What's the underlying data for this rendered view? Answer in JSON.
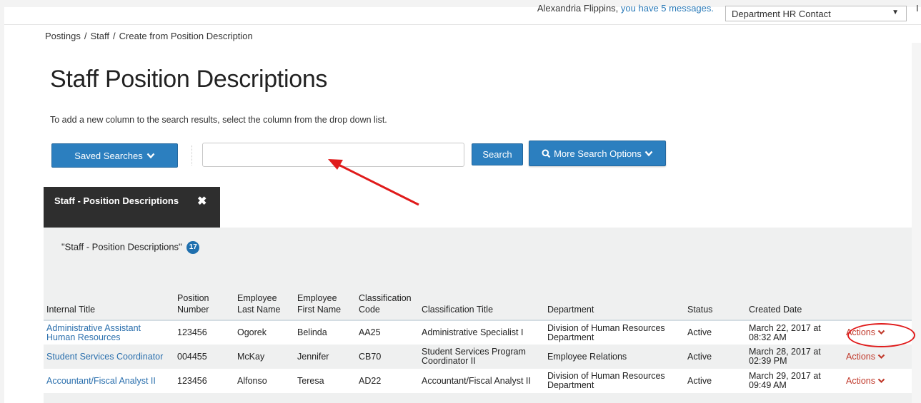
{
  "header": {
    "user_name": "Alexandria Flippins,",
    "messages_link": "you have 5 messages.",
    "role_select": "Department HR Contact",
    "corner": "I"
  },
  "breadcrumb": [
    "Postings",
    "Staff",
    "Create from Position Description"
  ],
  "page_title": "Staff Position Descriptions",
  "help_text": "To add a new column to the search results, select the column from the drop down list.",
  "toolbar": {
    "saved_searches": "Saved Searches",
    "search_value": "",
    "search_button": "Search",
    "more_options": "More Search Options"
  },
  "tab": {
    "label": "Staff - Position Descriptions"
  },
  "results": {
    "title": "\"Staff - Position Descriptions\"",
    "count": "17",
    "columns": [
      "Internal Title",
      "Position Number",
      "Employee Last Name",
      "Employee First Name",
      "Classification Code",
      "Classification Title",
      "Department",
      "Status",
      "Created Date",
      ""
    ],
    "rows": [
      {
        "internal_title": "Administrative Assistant Human Resources",
        "position_number": "123456",
        "last_name": "Ogorek",
        "first_name": "Belinda",
        "class_code": "AA25",
        "class_title": "Administrative Specialist I",
        "department": "Division of Human Resources Department",
        "status": "Active",
        "created": "March 22, 2017 at 08:32 AM",
        "actions": "Actions"
      },
      {
        "internal_title": "Student Services Coordinator",
        "position_number": "004455",
        "last_name": "McKay",
        "first_name": "Jennifer",
        "class_code": "CB70",
        "class_title": "Student Services Program Coordinator II",
        "department": "Employee Relations",
        "status": "Active",
        "created": "March 28, 2017 at 02:39 PM",
        "actions": "Actions"
      },
      {
        "internal_title": "Accountant/Fiscal Analyst II",
        "position_number": "123456",
        "last_name": "Alfonso",
        "first_name": "Teresa",
        "class_code": "AD22",
        "class_title": "Accountant/Fiscal Analyst II",
        "department": "Division of Human Resources Department",
        "status": "Active",
        "created": "March 29, 2017 at 09:49 AM",
        "actions": "Actions"
      }
    ]
  },
  "colors": {
    "primary_button": "#2c7fbf",
    "link": "#2a6fad",
    "actions": "#c0392b",
    "annotation": "#e01b1b"
  },
  "icons": {
    "saved_caret": "chevron-down-icon",
    "more_search": "search-icon",
    "tab_close": "close-icon",
    "actions_caret": "chevron-down-icon"
  }
}
